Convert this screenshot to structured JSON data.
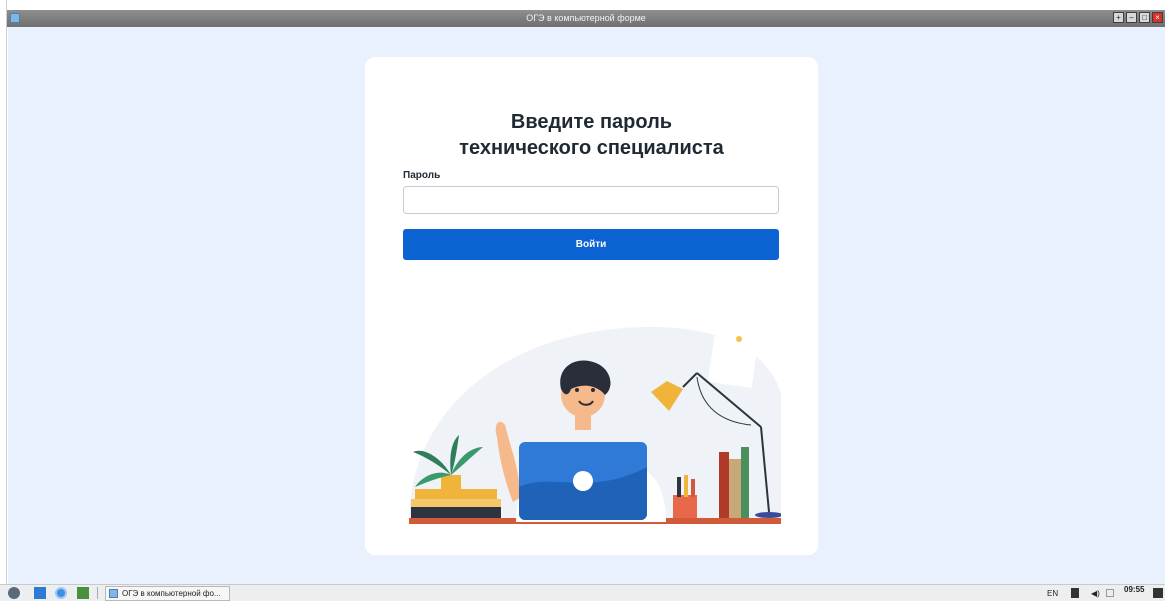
{
  "window": {
    "title": "ОГЭ в компьютерной форме",
    "controls": [
      "plus-icon",
      "minimize-icon",
      "restore-icon",
      "close-icon"
    ]
  },
  "login": {
    "heading_line1": "Введите пароль",
    "heading_line2": "технического специалиста",
    "password_label": "Пароль",
    "password_value": "",
    "password_placeholder": "",
    "submit_label": "Войти"
  },
  "colors": {
    "background": "#e8f1fd",
    "card": "#ffffff",
    "accent": "#0b63d1"
  },
  "taskbar": {
    "task_label": "ОГЭ в компьютерной фо...",
    "language": "EN",
    "time": "09:55",
    "icons": [
      "start-menu-icon",
      "file-manager-icon",
      "browser-icon",
      "terminal-icon"
    ]
  }
}
